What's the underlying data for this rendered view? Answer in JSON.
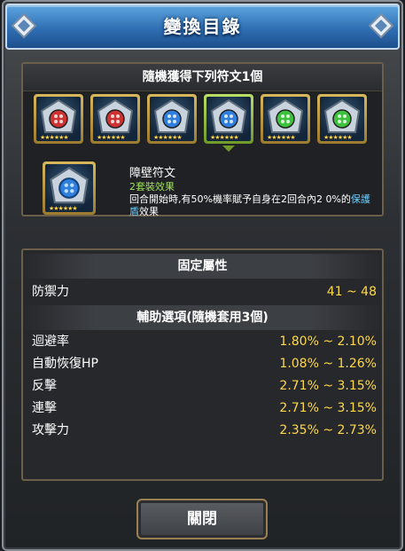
{
  "window": {
    "title": "變換目錄"
  },
  "runes_panel": {
    "header": "隨機獲得下列符文1個",
    "runes": [
      {
        "color": "#d03232",
        "icon": "red-rune-icon",
        "stars": "★★★★★★"
      },
      {
        "color": "#d03232",
        "icon": "red-rune-icon",
        "stars": "★★★★★★"
      },
      {
        "color": "#2f7fe0",
        "icon": "blue-rune-icon",
        "stars": "★★★★★★"
      },
      {
        "color": "#2f7fe0",
        "icon": "blue-rune-icon",
        "stars": "★★★★★★"
      },
      {
        "color": "#3cc23c",
        "icon": "green-rune-icon",
        "stars": "★★★★★★"
      },
      {
        "color": "#3cc23c",
        "icon": "green-rune-icon",
        "stars": "★★★★★★"
      }
    ],
    "selected_index": 3,
    "detail": {
      "name": "障壁符文",
      "set_effect": "2套裝效果",
      "desc_pre": "回合開始時,有50%機率賦予自身在2回合內2 0%的",
      "desc_highlight": "保護盾",
      "desc_post": "效果",
      "stars": "★★★★★★"
    }
  },
  "stats_panel": {
    "fixed_header": "固定屬性",
    "fixed": [
      {
        "label": "防禦力",
        "value": "41 ~ 48"
      }
    ],
    "aux_header": "輔助選項(隨機套用3個)",
    "aux": [
      {
        "label": "迴避率",
        "value": "1.80% ~ 2.10%"
      },
      {
        "label": "自動恢復HP",
        "value": "1.08% ~ 1.26%"
      },
      {
        "label": "反擊",
        "value": "2.71% ~ 3.15%"
      },
      {
        "label": "連擊",
        "value": "2.71% ~ 3.15%"
      },
      {
        "label": "攻擊力",
        "value": "2.35% ~ 2.73%"
      }
    ]
  },
  "close_button": {
    "label": "關閉"
  }
}
